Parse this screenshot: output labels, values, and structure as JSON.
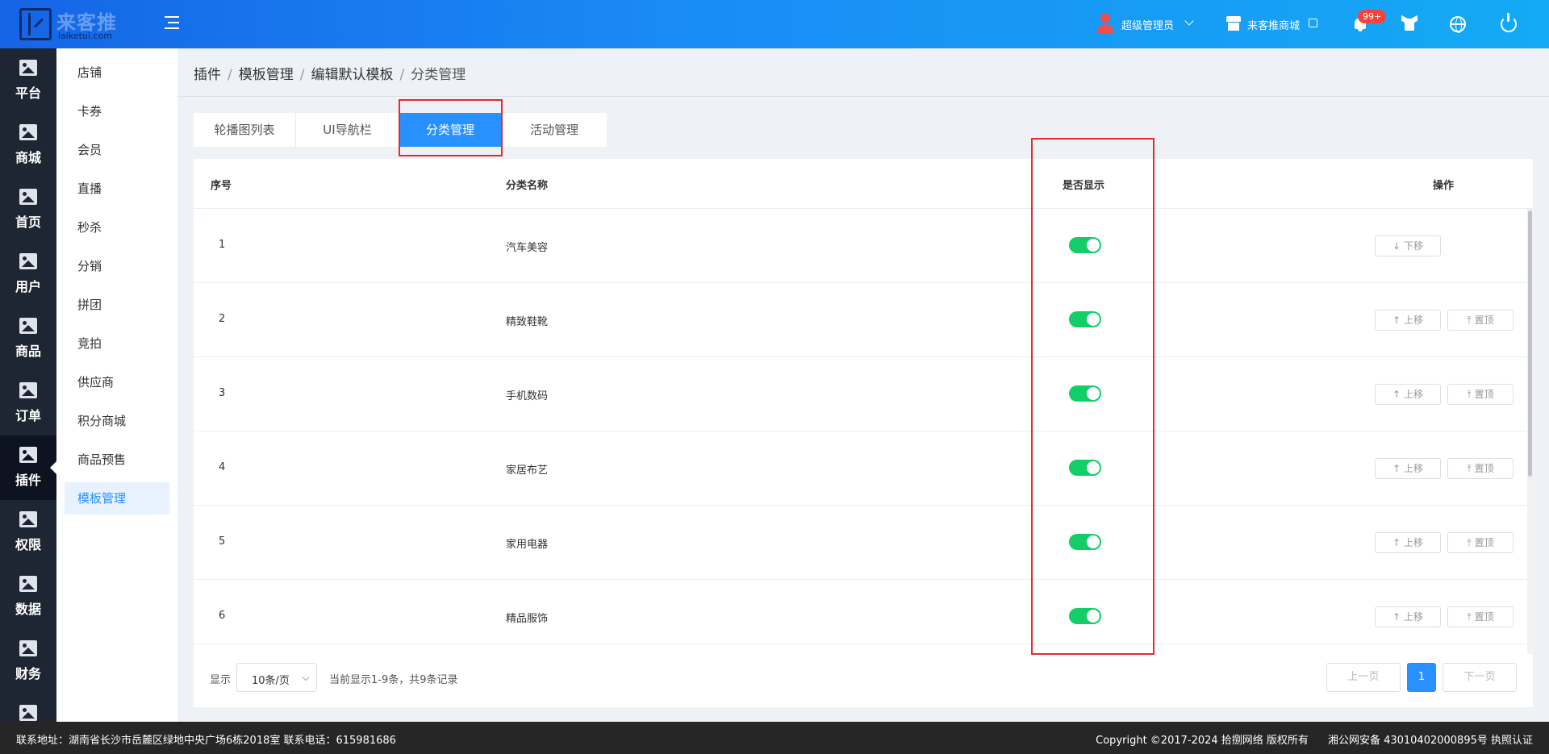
{
  "header": {
    "logo_text": "来客推",
    "logo_domain": "laiketui.com",
    "user_name": "超级管理员",
    "shop_label": "来客推商城",
    "notification_badge": "99+"
  },
  "leftnav": {
    "items": [
      {
        "label": "平台"
      },
      {
        "label": "商城"
      },
      {
        "label": "首页"
      },
      {
        "label": "用户"
      },
      {
        "label": "商品"
      },
      {
        "label": "订单"
      },
      {
        "label": "插件",
        "active": true
      },
      {
        "label": "权限"
      },
      {
        "label": "数据"
      },
      {
        "label": "财务"
      }
    ]
  },
  "subnav": {
    "items": [
      {
        "label": "店铺"
      },
      {
        "label": "卡券"
      },
      {
        "label": "会员"
      },
      {
        "label": "直播"
      },
      {
        "label": "秒杀"
      },
      {
        "label": "分销"
      },
      {
        "label": "拼团"
      },
      {
        "label": "竞拍"
      },
      {
        "label": "供应商"
      },
      {
        "label": "积分商城"
      },
      {
        "label": "商品预售"
      },
      {
        "label": "模板管理",
        "active": true
      }
    ]
  },
  "breadcrumb": [
    "插件",
    "模板管理",
    "编辑默认模板",
    "分类管理"
  ],
  "tabs": [
    {
      "label": "轮播图列表"
    },
    {
      "label": "UI导航栏"
    },
    {
      "label": "分类管理",
      "active": true
    },
    {
      "label": "活动管理"
    }
  ],
  "table": {
    "columns": {
      "index": "序号",
      "name": "分类名称",
      "visible": "是否显示",
      "actions": "操作"
    },
    "move_down_label": "下移",
    "move_up_label": "上移",
    "top_label": "置顶",
    "rows": [
      {
        "index": "1",
        "name": "汽车美容",
        "visible": true
      },
      {
        "index": "2",
        "name": "精致鞋靴",
        "visible": true
      },
      {
        "index": "3",
        "name": "手机数码",
        "visible": true
      },
      {
        "index": "4",
        "name": "家居布艺",
        "visible": true
      },
      {
        "index": "5",
        "name": "家用电器",
        "visible": true
      },
      {
        "index": "6",
        "name": "精品服饰",
        "visible": true
      }
    ]
  },
  "pagination": {
    "show_label": "显示",
    "page_size": "10条/页",
    "info": "当前显示1-9条，共9条记录",
    "prev": "上一页",
    "current_page": "1",
    "next": "下一页"
  },
  "footer": {
    "address": "联系地址：湖南省长沙市岳麓区绿地中央广场6栋2018室 联系电话：615981686",
    "copyright": "Copyright ©2017-2024 拾捌网络 版权所有",
    "icp": "湘公网安备 43010402000895号 执照认证"
  },
  "colors": {
    "accent": "#2890ff",
    "switch_on": "#13ce66",
    "nav_bg": "#1e2634",
    "highlight": "#e82a2a"
  }
}
